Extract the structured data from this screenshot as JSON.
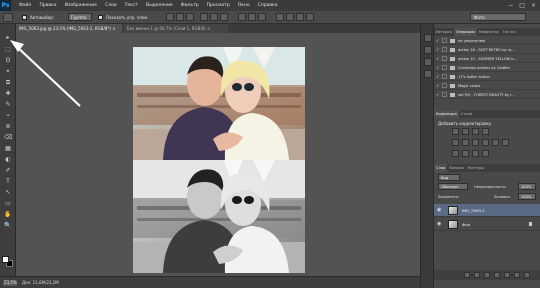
{
  "app": {
    "logo": "Ps",
    "menu": [
      "Файл",
      "Правка",
      "Изображение",
      "Слои",
      "Текст",
      "Выделение",
      "Фильтр",
      "Просмотр",
      "Окно",
      "Справка"
    ],
    "window_controls": [
      "−",
      "□",
      "×"
    ]
  },
  "options": {
    "autoselect_label": "Автовыбор:",
    "autoselect_value": "Группа",
    "transform_label": "Показать упр. элем.",
    "workspace": "Фото"
  },
  "tabs": [
    {
      "label": "IMG_5063.jpg @ 23,5% (IMG_5063-2, RGB/8*) ×"
    },
    {
      "label": "Без имени-1 @ 66,7% (Слой 1, RGB/8) ×"
    }
  ],
  "tools": [
    "▸",
    "⬚",
    "ʘ",
    "⌖",
    "⧉",
    "✚",
    "✎",
    "⌁",
    "⊚",
    "⌫",
    "▦",
    "◐",
    "✐",
    "T",
    "↖",
    "▭",
    "✋",
    "🔍"
  ],
  "status": {
    "zoom": "23,5%",
    "doc_info": "Док: 11,6М/23,2М"
  },
  "panels": {
    "top_tabs": [
      "История",
      "Операции",
      "Навигатор",
      "Гистог."
    ],
    "actions": [
      {
        "label": "по умолчанию"
      },
      {
        "label": "action 16 - SOFT RETRO by ro..."
      },
      {
        "label": "action 10 - SUMMER YELLOW b..."
      },
      {
        "label": "Christmas actions by Cadfire"
      },
      {
        "label": "17's Softer Action"
      },
      {
        "label": "Magic colors"
      },
      {
        "label": "set 9/5 - FOREST BEAUTY by r..."
      }
    ],
    "adjustments_tabs": [
      "Коррекция",
      "Стили"
    ],
    "adjustments_title": "Добавить корректировку",
    "layers_tabs": [
      "Слои",
      "Каналы",
      "Контуры"
    ],
    "layers_filter": "Вид",
    "blend_mode": "Обычные",
    "opacity_label": "Непрозрачность:",
    "opacity_value": "100%",
    "lock_label": "Закрепить:",
    "fill_label": "Заливка:",
    "fill_value": "100%",
    "layers": [
      {
        "name": "IMG_5063-2",
        "selected": true
      },
      {
        "name": "Фон",
        "selected": false
      }
    ]
  }
}
